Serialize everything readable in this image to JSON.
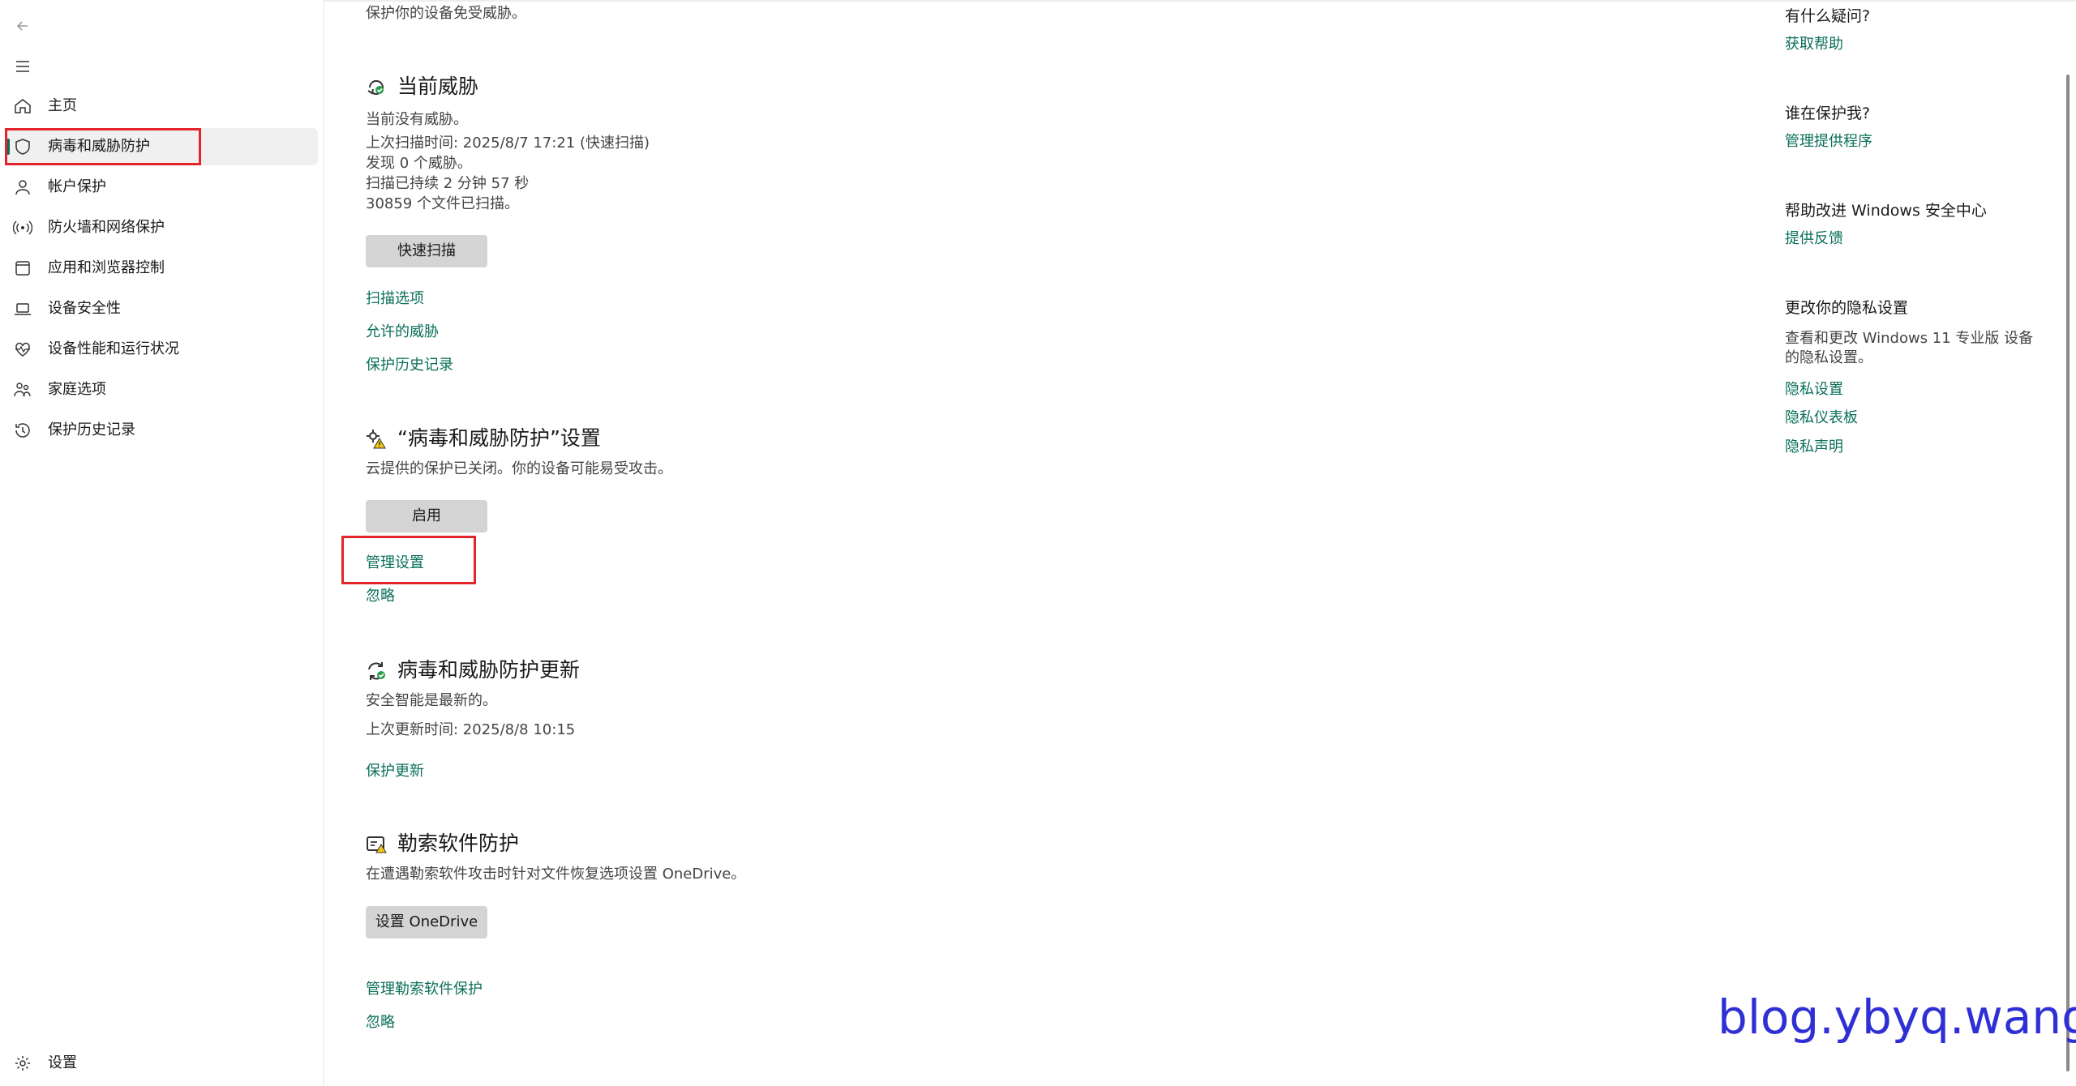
{
  "sidebar": {
    "back_icon": "back-arrow-icon",
    "menu_icon": "hamburger-menu-icon",
    "items": [
      {
        "label": "主页",
        "icon": "home-icon"
      },
      {
        "label": "病毒和威胁防护",
        "icon": "shield-icon",
        "selected": true
      },
      {
        "label": "帐户保护",
        "icon": "person-icon"
      },
      {
        "label": "防火墙和网络保护",
        "icon": "wifi-antenna-icon"
      },
      {
        "label": "应用和浏览器控制",
        "icon": "app-window-icon"
      },
      {
        "label": "设备安全性",
        "icon": "laptop-icon"
      },
      {
        "label": "设备性能和运行状况",
        "icon": "heart-pulse-icon"
      },
      {
        "label": "家庭选项",
        "icon": "family-icon"
      },
      {
        "label": "保护历史记录",
        "icon": "history-icon"
      }
    ],
    "settings": {
      "label": "设置",
      "icon": "gear-icon"
    }
  },
  "main": {
    "intro": "保护你的设备免受威胁。",
    "current_threats": {
      "title": "当前威胁",
      "lines": [
        "当前没有威胁。",
        "上次扫描时间: 2025/8/7 17:21 (快速扫描)",
        "发现 0 个威胁。",
        "扫描已持续 2 分钟 57 秒",
        "30859 个文件已扫描。"
      ],
      "button": "快速扫描",
      "links": [
        "扫描选项",
        "允许的威胁",
        "保护历史记录"
      ]
    },
    "protection_settings": {
      "title": "“病毒和威胁防护”设置",
      "description": "云提供的保护已关闭。你的设备可能易受攻击。",
      "button": "启用",
      "links": [
        "管理设置",
        "忽略"
      ]
    },
    "updates": {
      "title": "病毒和威胁防护更新",
      "lines": [
        "安全智能是最新的。",
        "上次更新时间: 2025/8/8 10:15"
      ],
      "link": "保护更新"
    },
    "ransomware": {
      "title": "勒索软件防护",
      "description": "在遭遇勒索软件攻击时针对文件恢复选项设置 OneDrive。",
      "button": "设置 OneDrive",
      "links": [
        "管理勒索软件保护",
        "忽略"
      ]
    }
  },
  "right_panel": {
    "questions": {
      "heading": "有什么疑问?",
      "link": "获取帮助"
    },
    "protector": {
      "heading": "谁在保护我?",
      "link": "管理提供程序"
    },
    "feedback": {
      "heading": "帮助改进 Windows 安全中心",
      "link": "提供反馈"
    },
    "privacy": {
      "heading": "更改你的隐私设置",
      "text": "查看和更改 Windows 11 专业版 设备的隐私设置。",
      "links": [
        "隐私设置",
        "隐私仪表板",
        "隐私声明"
      ]
    }
  },
  "watermark": "blog.ybyq.wang",
  "colors": {
    "link": "#0a6f59",
    "annotation": "#e3242b",
    "button": "#d4d4d4"
  }
}
